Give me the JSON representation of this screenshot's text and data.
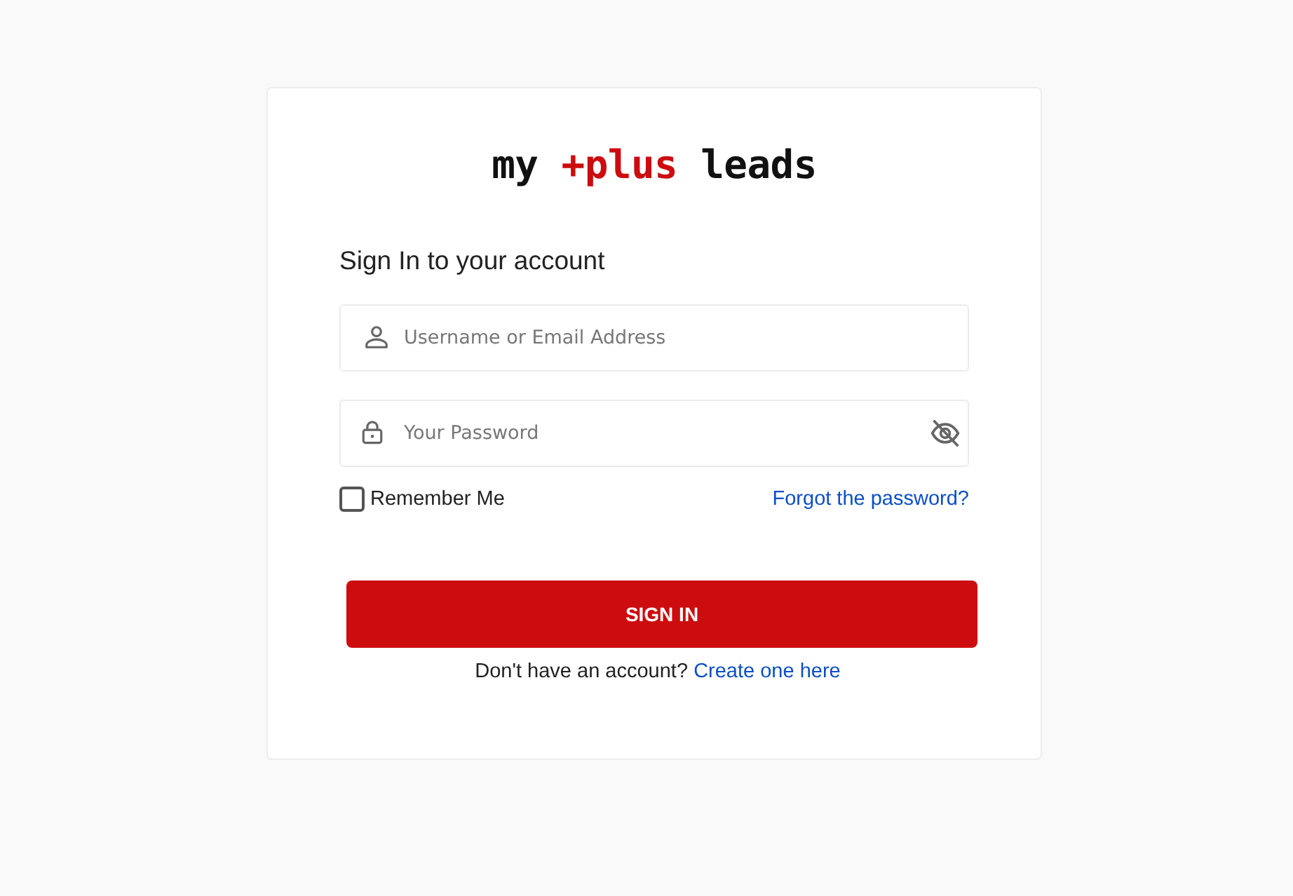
{
  "logo": {
    "parts": [
      {
        "text": "my",
        "accent": false
      },
      {
        "text": "+plus",
        "accent": true
      },
      {
        "text": "leads",
        "accent": false
      }
    ]
  },
  "heading": "Sign In to your account",
  "fields": [
    {
      "kind": "username",
      "placeholder": "Username or Email Address"
    },
    {
      "kind": "password",
      "placeholder": "Your Password"
    }
  ],
  "remember": {
    "label": "Remember Me",
    "checked": false
  },
  "forgot_link": "Forgot the password?",
  "submit_button": "SIGN IN",
  "signup": {
    "text": "Don't have an account?",
    "link": "Create one here"
  }
}
